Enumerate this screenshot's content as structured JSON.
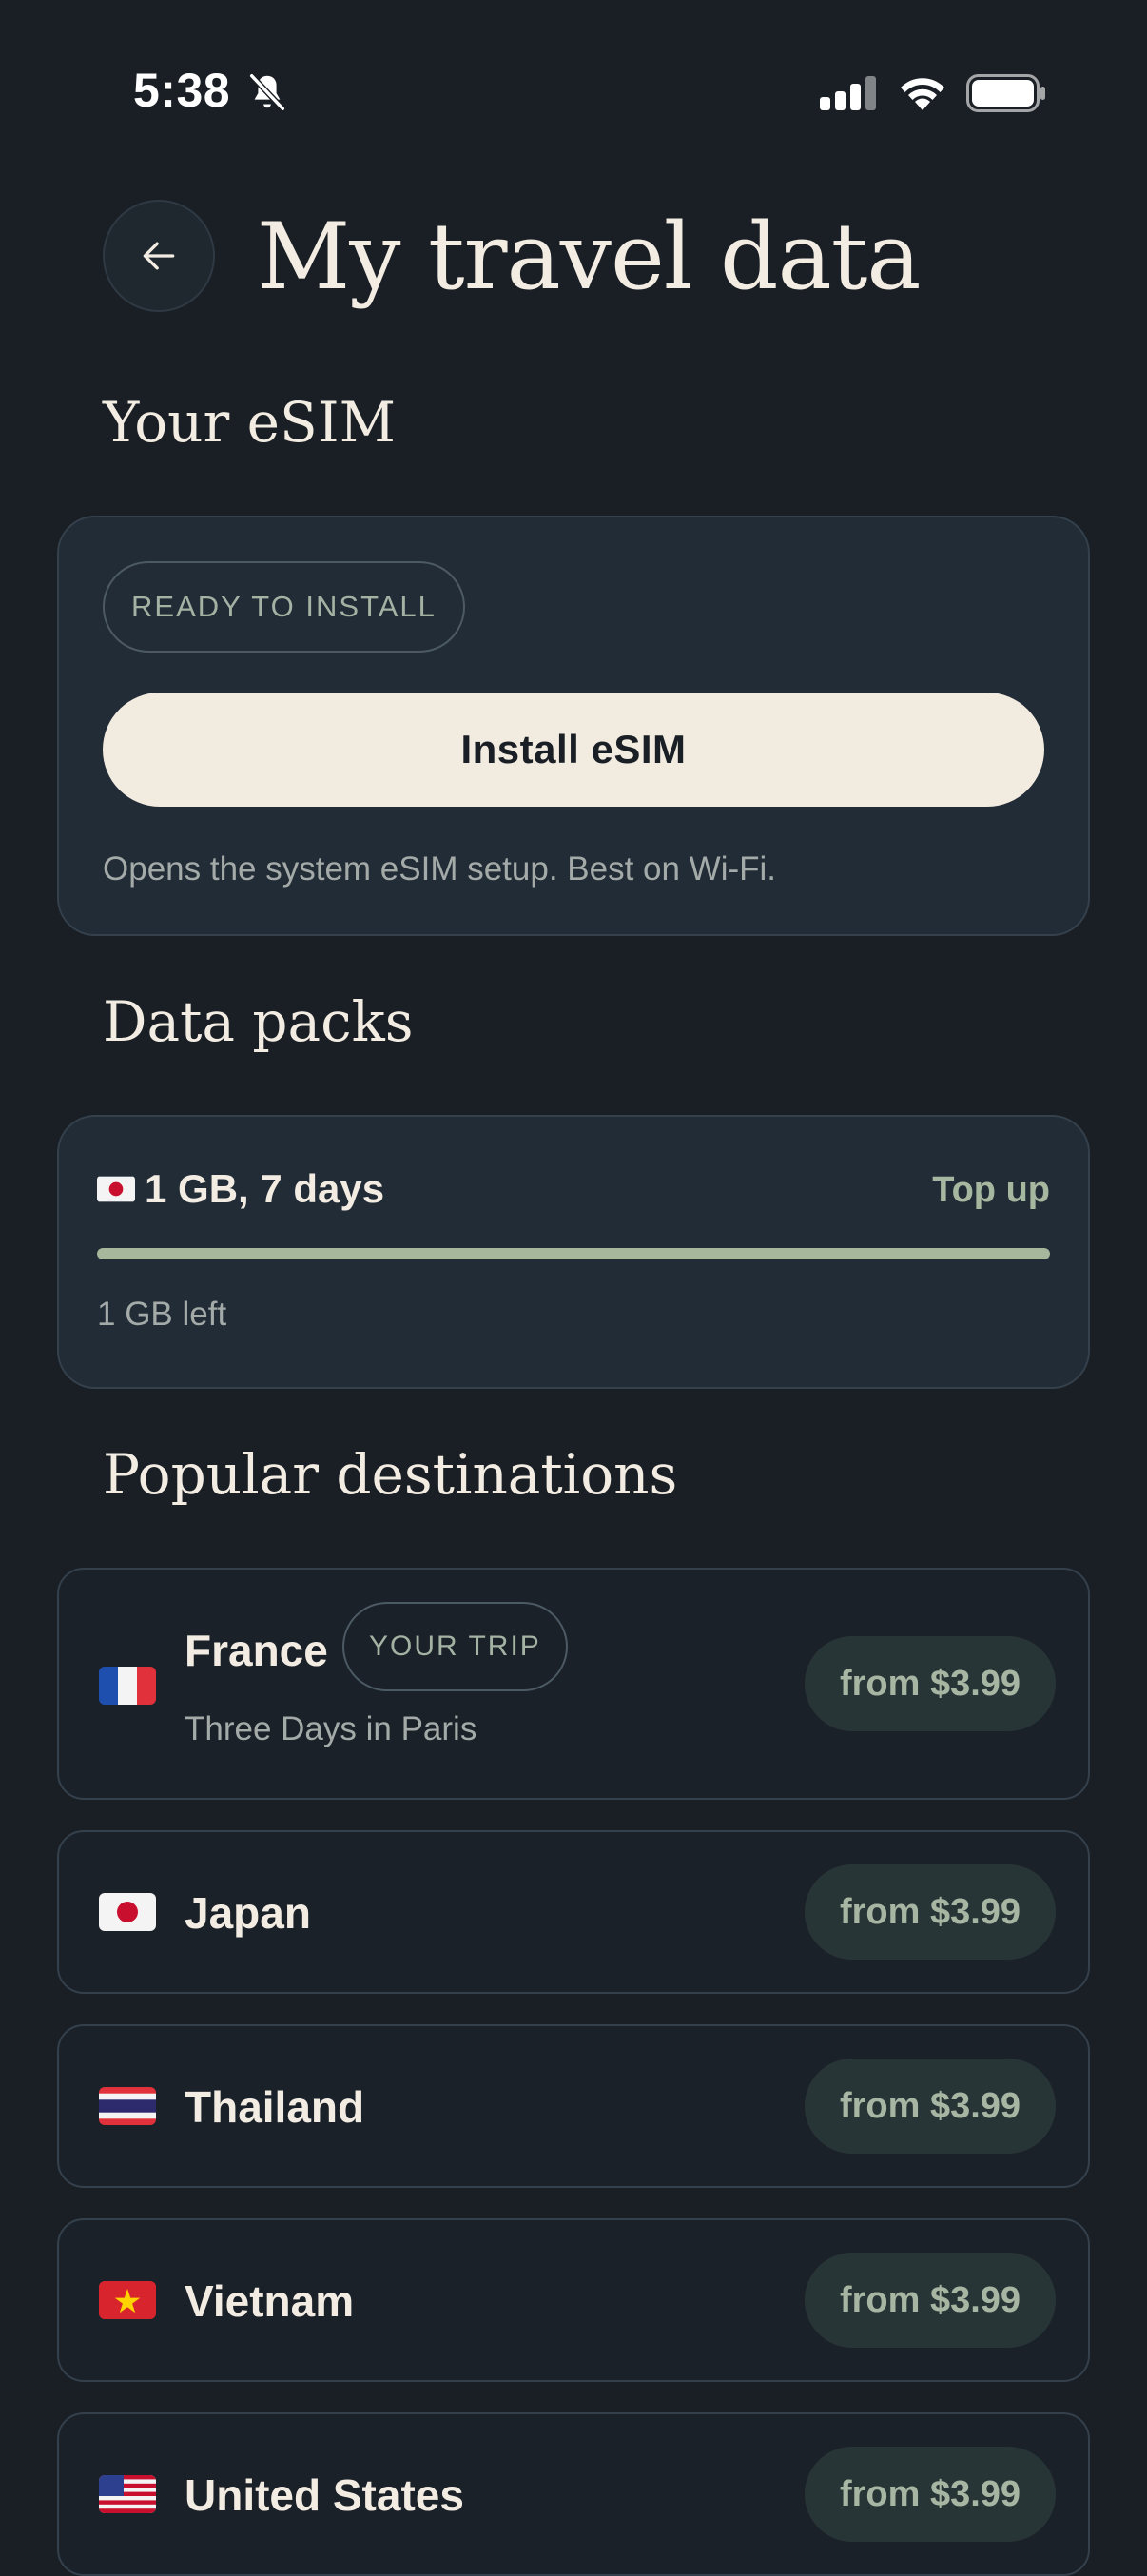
{
  "status_bar": {
    "time": "5:38"
  },
  "header": {
    "title": "My travel data"
  },
  "esim_section": {
    "title": "Your eSIM",
    "status_badge": "READY TO INSTALL",
    "install_button": "Install eSIM",
    "hint": "Opens the system eSIM setup. Best on Wi-Fi."
  },
  "packs_section": {
    "title": "Data packs",
    "pack": {
      "label": "1 GB, 7 days",
      "action": "Top up",
      "remaining_text": "1 GB left",
      "remaining_fraction": 1.0
    }
  },
  "destinations_section": {
    "title": "Popular destinations",
    "items": [
      {
        "name": "France",
        "badge": "YOUR TRIP",
        "subtitle": "Three Days in Paris",
        "price": "from $3.99",
        "flag": "france-flag-icon"
      },
      {
        "name": "Japan",
        "price": "from $3.99",
        "flag": "japan-flag-icon"
      },
      {
        "name": "Thailand",
        "price": "from $3.99",
        "flag": "thailand-flag-icon"
      },
      {
        "name": "Vietnam",
        "price": "from $3.99",
        "flag": "vietnam-flag-icon"
      },
      {
        "name": "United States",
        "price": "from $3.99",
        "flag": "usa-flag-icon"
      }
    ]
  },
  "colors": {
    "background": "#1a1f25",
    "card": "#222c37",
    "accent": "#a6b79c",
    "cream": "#f2ebe0"
  }
}
